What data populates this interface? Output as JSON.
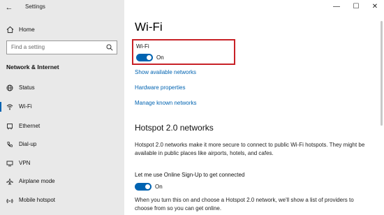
{
  "window": {
    "title": "Settings",
    "controls": {
      "minimize": "—",
      "maximize": "☐",
      "close": "✕"
    }
  },
  "sidebar": {
    "home": "Home",
    "search_placeholder": "Find a setting",
    "section": "Network & Internet",
    "items": [
      {
        "label": "Status",
        "icon": "globe-icon"
      },
      {
        "label": "Wi-Fi",
        "icon": "wifi-icon",
        "active": true
      },
      {
        "label": "Ethernet",
        "icon": "ethernet-icon"
      },
      {
        "label": "Dial-up",
        "icon": "phone-icon"
      },
      {
        "label": "VPN",
        "icon": "vpn-icon"
      },
      {
        "label": "Airplane mode",
        "icon": "airplane-icon"
      },
      {
        "label": "Mobile hotspot",
        "icon": "hotspot-icon"
      }
    ]
  },
  "main": {
    "title": "Wi-Fi",
    "wifi_toggle": {
      "label": "Wi-Fi",
      "state": "On"
    },
    "links": [
      "Show available networks",
      "Hardware properties",
      "Manage known networks"
    ],
    "hotspot": {
      "title": "Hotspot 2.0 networks",
      "description": "Hotspot 2.0 networks make it more secure to connect to public Wi-Fi hotspots. They might be available in public places like airports, hotels, and cafes.",
      "signup_label": "Let me use Online Sign-Up to get connected",
      "signup_state": "On",
      "footer_text": "When you turn this on and choose a Hotspot 2.0 network, we'll show a list of providers to choose from so you can get online."
    }
  },
  "colors": {
    "accent": "#0063b1",
    "highlight": "#c82127",
    "sidebar_bg": "#e9e9e9"
  }
}
